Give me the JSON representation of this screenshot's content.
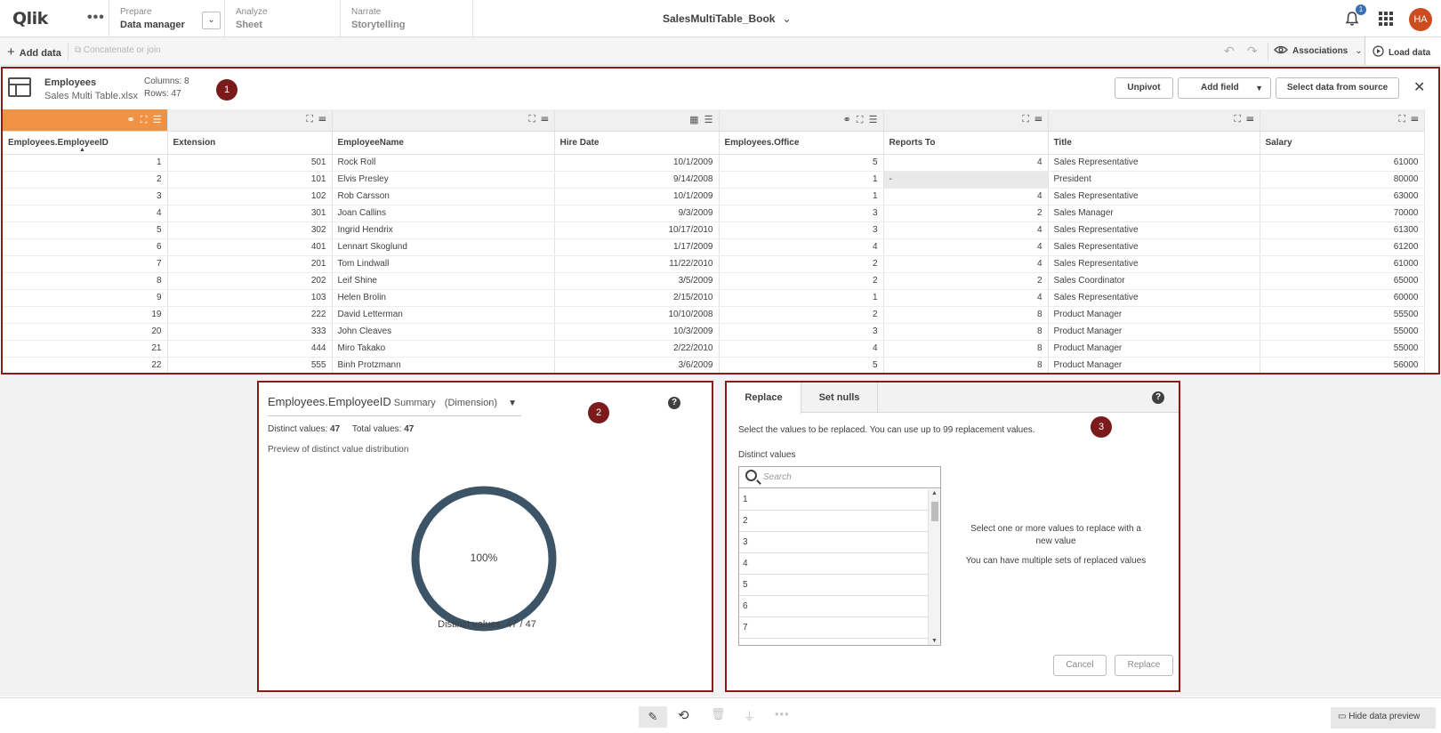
{
  "topbar": {
    "logo_text": "Qlik",
    "nav": [
      {
        "label": "Prepare",
        "sub": "Data manager"
      },
      {
        "label": "Analyze",
        "sub": "Sheet"
      },
      {
        "label": "Narrate",
        "sub": "Storytelling"
      }
    ],
    "nav_dropdown_icon": "chevron-down",
    "app_title": "SalesMultiTable_Book",
    "notification_count": "1",
    "avatar_initials": "HA"
  },
  "toolbar": {
    "add_data": "Add data",
    "concatenate": "Concatenate or join",
    "associations": "Associations",
    "load_data": "Load data"
  },
  "table_panel": {
    "marker": "1",
    "table_name": "Employees",
    "file_name": "Sales Multi Table.xlsx",
    "columns_text": "Columns: 8",
    "rows_text": "Rows: 47",
    "buttons": {
      "unpivot": "Unpivot",
      "add_field": "Add field",
      "select_source": "Select data from source"
    },
    "accent_color": "#ef9244",
    "headers": [
      "Employees.EmployeeID",
      "Extension",
      "EmployeeName",
      "Hire Date",
      "Employees.Office",
      "Reports To",
      "Title",
      "Salary"
    ],
    "rows": [
      [
        "1",
        "501",
        "Rock Roll",
        "10/1/2009",
        "5",
        "4",
        "Sales Representative",
        "61000"
      ],
      [
        "2",
        "101",
        "Elvis Presley",
        "9/14/2008",
        "1",
        "-",
        "President",
        "80000"
      ],
      [
        "3",
        "102",
        "Rob Carsson",
        "10/1/2009",
        "1",
        "4",
        "Sales Representative",
        "63000"
      ],
      [
        "4",
        "301",
        "Joan Callins",
        "9/3/2009",
        "3",
        "2",
        "Sales Manager",
        "70000"
      ],
      [
        "5",
        "302",
        "Ingrid Hendrix",
        "10/17/2010",
        "3",
        "4",
        "Sales Representative",
        "61300"
      ],
      [
        "6",
        "401",
        "Lennart Skoglund",
        "1/17/2009",
        "4",
        "4",
        "Sales Representative",
        "61200"
      ],
      [
        "7",
        "201",
        "Tom Lindwall",
        "11/22/2010",
        "2",
        "4",
        "Sales Representative",
        "61000"
      ],
      [
        "8",
        "202",
        "Leif Shine",
        "3/5/2009",
        "2",
        "2",
        "Sales Coordinator",
        "65000"
      ],
      [
        "9",
        "103",
        "Helen Brolin",
        "2/15/2010",
        "1",
        "4",
        "Sales Representative",
        "60000"
      ],
      [
        "19",
        "222",
        "David Letterman",
        "10/10/2008",
        "2",
        "8",
        "Product Manager",
        "55500"
      ],
      [
        "20",
        "333",
        "John Cleaves",
        "10/3/2009",
        "3",
        "8",
        "Product Manager",
        "55000"
      ],
      [
        "21",
        "444",
        "Miro Takako",
        "2/22/2010",
        "4",
        "8",
        "Product Manager",
        "55000"
      ],
      [
        "22",
        "555",
        "Binh Protzmann",
        "3/6/2009",
        "5",
        "8",
        "Product Manager",
        "56000"
      ]
    ]
  },
  "summary_panel": {
    "marker": "2",
    "field": "Employees.EmployeeID",
    "view": "Summary",
    "type": "(Dimension)",
    "distinct_label": "Distinct values:",
    "distinct_value": "47",
    "total_label": "Total values:",
    "total_value": "47",
    "preview_label": "Preview of distinct value distribution",
    "donut_label": "100%",
    "donut_fraction": 1.0,
    "donut_color": "#3d5466",
    "distinct_footer": "Distinct values: 47 / 47"
  },
  "replace_panel": {
    "marker": "3",
    "tabs": [
      "Replace",
      "Set nulls"
    ],
    "instruction": "Select the values to be replaced. You can use up to 99 replacement values.",
    "distinct_label": "Distinct values",
    "search_placeholder": "Search",
    "values": [
      "1",
      "2",
      "3",
      "4",
      "5",
      "6",
      "7"
    ],
    "hint1": "Select one or more values to replace with a new value",
    "hint2": "You can have multiple sets of replaced values",
    "cancel": "Cancel",
    "replace": "Replace"
  },
  "bottombar": {
    "hide_preview": "Hide data preview"
  },
  "colors": {
    "panel_border": "#8b1a1a",
    "marker_bg": "#7a1a1a"
  }
}
